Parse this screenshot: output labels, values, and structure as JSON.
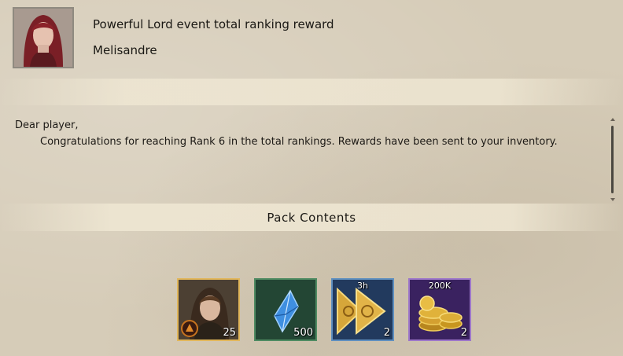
{
  "mail": {
    "title": "Powerful Lord event total ranking reward",
    "sender": "Melisandre",
    "greeting": "Dear player,",
    "body": "Congratulations for reaching Rank 6 in the total rankings. Rewards have been sent to your inventory."
  },
  "pack": {
    "title": "Pack Contents",
    "items": [
      {
        "icon": "hero-portrait-icon",
        "quantity": "25",
        "top_label": ""
      },
      {
        "icon": "blue-crystal-icon",
        "quantity": "500",
        "top_label": ""
      },
      {
        "icon": "speedup-arrows-icon",
        "quantity": "2",
        "top_label": "3h"
      },
      {
        "icon": "gold-coins-icon",
        "quantity": "2",
        "top_label": "200K"
      }
    ]
  },
  "colors": {
    "background": "#d6ccb8",
    "item_border_legendary": "#e1b65a",
    "item_border_green": "#4f8b62",
    "item_border_blue": "#5f8fbf",
    "item_border_purple": "#9c76c9"
  }
}
